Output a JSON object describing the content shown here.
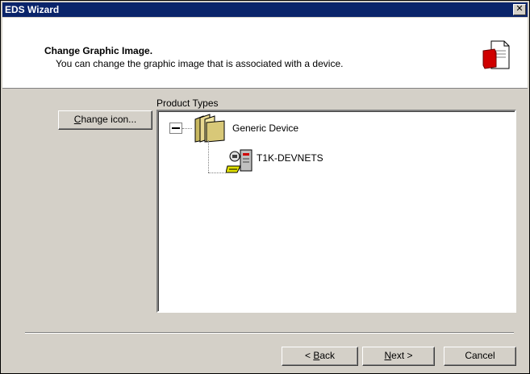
{
  "window": {
    "title": "EDS Wizard"
  },
  "header": {
    "title": "Change Graphic Image.",
    "subtitle": "You can change the graphic image that is associated with a device.",
    "icon": "document-icon"
  },
  "left": {
    "change_icon_prefix": "C",
    "change_icon_rest": "hange icon..."
  },
  "tree": {
    "group_label": "Product Types",
    "nodes": [
      {
        "label": "Generic Device",
        "icon": "folder-icon",
        "expanded": true
      },
      {
        "label": "T1K-DEVNETS",
        "icon": "network-device-icon"
      }
    ]
  },
  "footer": {
    "back_prefix": "< ",
    "back_u": "B",
    "back_rest": "ack",
    "next_u": "N",
    "next_rest": "ext >",
    "cancel": "Cancel"
  },
  "colors": {
    "titlebar": "#0a246a",
    "dialog_bg": "#d4d0c8",
    "accent_red": "#d00000"
  }
}
